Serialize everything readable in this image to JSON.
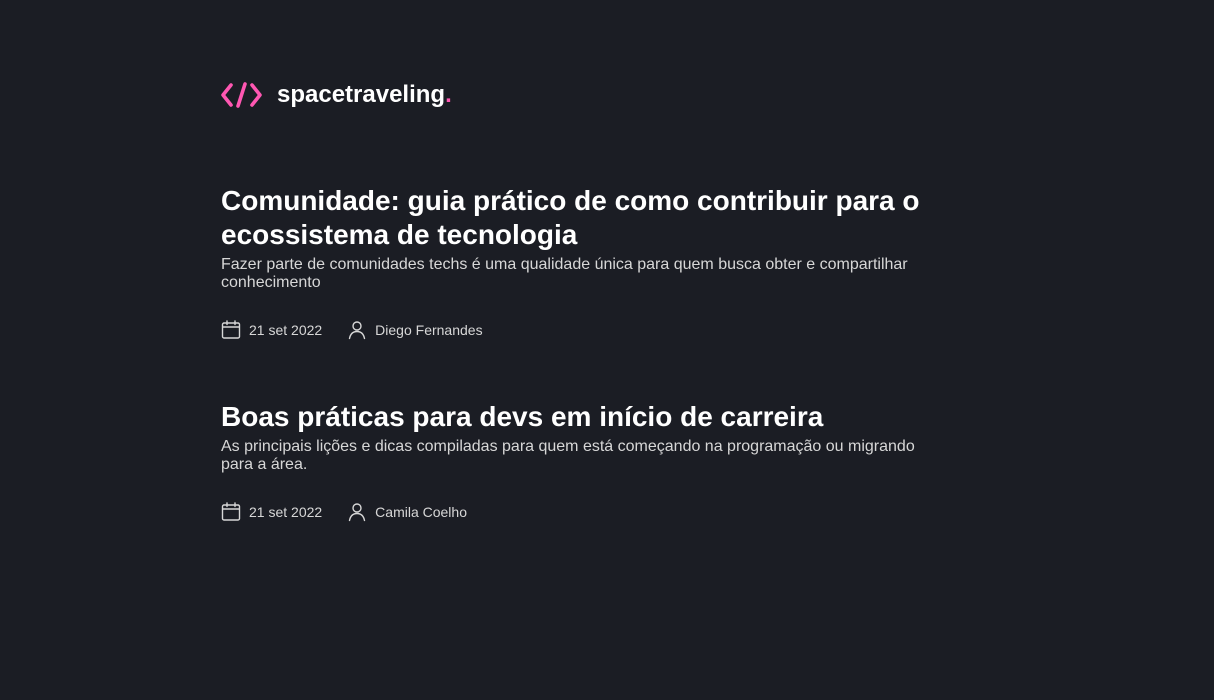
{
  "header": {
    "logo_icon": "code-brackets-icon",
    "brand_name": "spacetraveling",
    "brand_dot": ".",
    "accent_color": "#ff57b2"
  },
  "posts": [
    {
      "title": "Comunidade: guia prático de como contribuir para o ecossistema de tecnologia",
      "subtitle": "Fazer parte de comunidades techs é uma qualidade única para quem busca obter e compartilhar conhecimento",
      "date": "21 set 2022",
      "author": "Diego Fernandes",
      "date_icon": "calendar-icon",
      "author_icon": "user-icon"
    },
    {
      "title": "Boas práticas para devs em início de carreira",
      "subtitle": "As principais lições e dicas compiladas para quem está começando na programação ou migrando para a área.",
      "date": "21 set 2022",
      "author": "Camila Coelho",
      "date_icon": "calendar-icon",
      "author_icon": "user-icon"
    }
  ],
  "colors": {
    "background": "#1b1d24",
    "title": "#ffffff",
    "body_text": "#d7d7d7"
  }
}
